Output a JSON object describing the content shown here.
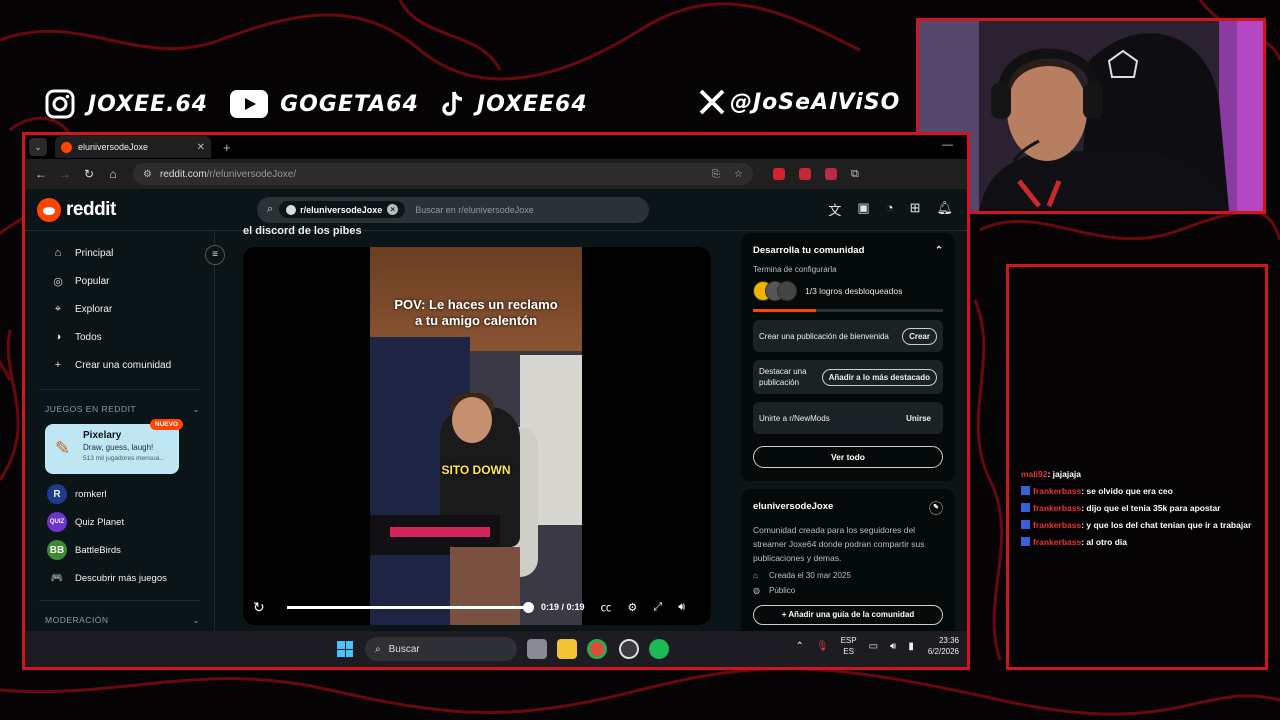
{
  "socials": {
    "instagram": "JOXEE.64",
    "youtube": "GOGETA64",
    "tiktok": "JOXEE64",
    "x": "@JoSeAlViSO"
  },
  "browser": {
    "tab_title": "eluniversodeJoxe",
    "url_host": "reddit.com",
    "url_path": "/r/eluniversodeJoxe/"
  },
  "reddit": {
    "logo": "reddit",
    "search_chip": "r/eluniversodeJoxe",
    "search_placeholder": "Buscar en r/eluniversodeJoxe",
    "nav": [
      {
        "icon": "home-icon",
        "label": "Principal"
      },
      {
        "icon": "popular-icon",
        "label": "Popular"
      },
      {
        "icon": "explore-icon",
        "label": "Explorar"
      },
      {
        "icon": "all-icon",
        "label": "Todos"
      },
      {
        "icon": "plus-icon",
        "label": "Crear una comunidad"
      }
    ],
    "games_section": "JUEGOS EN REDDIT",
    "game_card": {
      "name": "Pixelary",
      "subtitle": "Draw, guess, laugh!",
      "players": "513 mil jugadores mensua...",
      "badge": "NUEVO"
    },
    "games": [
      {
        "label": "romkerl",
        "icon_text": "R",
        "color": "#1d3b8f"
      },
      {
        "label": "Quiz Planet",
        "icon_text": "QUIZ",
        "color": "#6d34c9"
      },
      {
        "label": "BattleBirds",
        "icon_text": "BB",
        "color": "#3d8a35"
      },
      {
        "label": "Descubrir más juegos",
        "icon_text": "🎮",
        "color": "transparent"
      }
    ],
    "moderation_section": "MODERACIÓN",
    "post_title": "el discord de los pibes",
    "video": {
      "caption_line1": "POV: Le haces un reclamo",
      "caption_line2": "a tu amigo calentón",
      "overlay_text": "SITO DOWN",
      "time": "0:19 / 0:19",
      "progress": 1.0
    },
    "community_builder": {
      "title": "Desarrolla tu comunidad",
      "subtitle": "Termina de configurarla",
      "achievements": "1/3 logros desbloqueados",
      "progress": 0.33,
      "tasks": [
        {
          "label": "Crear una publicación de bienvenida",
          "button": "Crear"
        },
        {
          "label": "Destacar una publicación",
          "button": "Añadir a lo más destacado"
        },
        {
          "label": "Unirte a r/NewMods",
          "button": "Unirse"
        }
      ],
      "see_all": "Ver todo"
    },
    "community_info": {
      "name": "eluniversodeJoxe",
      "description": "Comunidad creada para los seguidores del streamer Joxe64 donde podran compartir sus publicaciones y demas.",
      "created": "Creada el 30 mar 2025",
      "visibility": "Público",
      "guide_button": "Añadir una guía de la comunidad"
    }
  },
  "taskbar": {
    "search": "Buscar",
    "lang_top": "ESP",
    "lang_bottom": "ES",
    "time": "23:36",
    "date": "6/2/2026"
  },
  "chat": [
    {
      "user": "mali92",
      "message": ": jajajaja",
      "badge": false,
      "user_color": "#e0343c"
    },
    {
      "user": "frankerbass",
      "message": ": se olvido que era ceo",
      "badge": true,
      "user_color": "#e0343c"
    },
    {
      "user": "frankerbass",
      "message": ": dijo que el tenia 35k para apostar",
      "badge": true,
      "user_color": "#e0343c"
    },
    {
      "user": "frankerbass",
      "message": ": y que los del chat tenian que ir a trabajar",
      "badge": true,
      "user_color": "#e0343c"
    },
    {
      "user": "frankerbass",
      "message": ": al otro dia",
      "badge": true,
      "user_color": "#e0343c"
    }
  ]
}
